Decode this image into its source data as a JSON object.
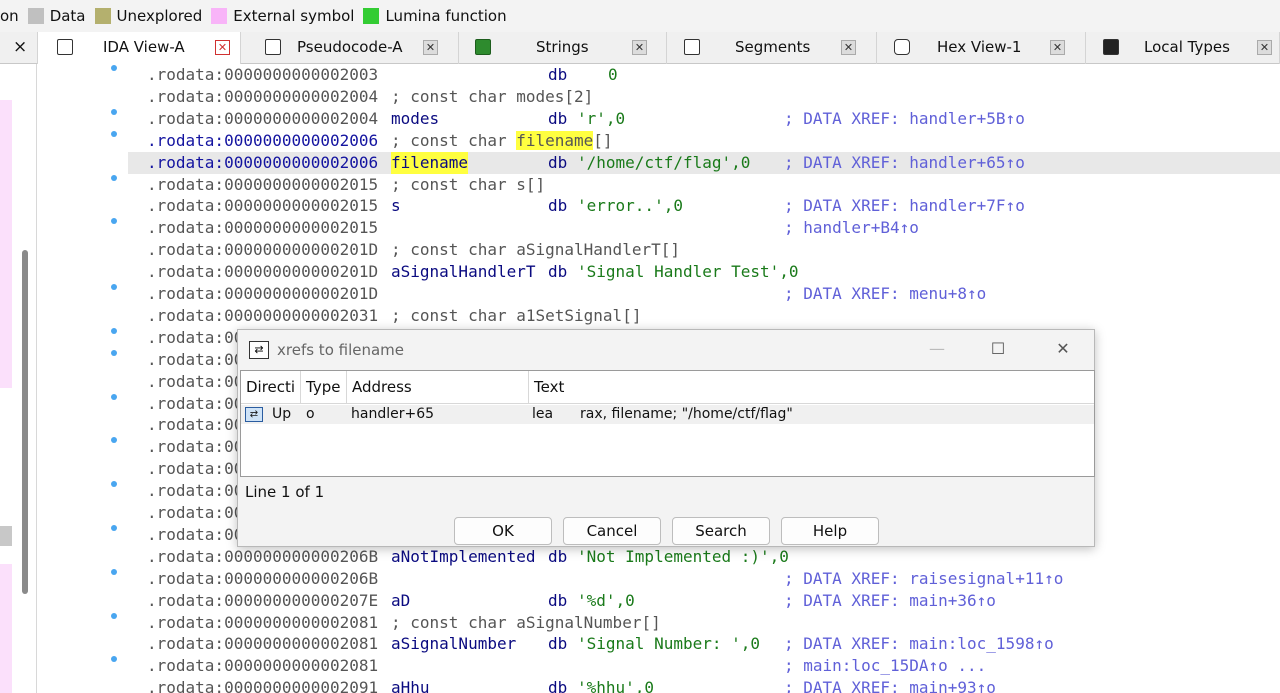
{
  "legend": [
    {
      "label": "on",
      "color": ""
    },
    {
      "label": "Data",
      "color": "#c0c0c0"
    },
    {
      "label": "Unexplored",
      "color": "#b4b06e"
    },
    {
      "label": "External symbol",
      "color": "#f8b4f8"
    },
    {
      "label": "Lumina function",
      "color": "#33cc33"
    }
  ],
  "tabs": [
    {
      "label": "IDA View-A",
      "active": true
    },
    {
      "label": "Pseudocode-A",
      "active": false
    },
    {
      "label": "Strings",
      "active": false
    },
    {
      "label": "Segments",
      "active": false
    },
    {
      "label": "Hex View-1",
      "active": false
    },
    {
      "label": "Local Types",
      "active": false
    }
  ],
  "left_close": "×",
  "listing": [
    {
      "addr": ".rodata:0000000000002003",
      "c3": "db",
      "c4": "0",
      "comment": "",
      "dot": true
    },
    {
      "addr": ".rodata:0000000000002004",
      "decl": "; const char modes[2]",
      "dot": false
    },
    {
      "addr": ".rodata:0000000000002004",
      "name": "modes",
      "c3": "db",
      "c4": "'r',0",
      "comment": "; DATA XREF: handler+5B↑o",
      "dot": true
    },
    {
      "addr": ".rodata:0000000000002006",
      "decl_pre": "; const char ",
      "decl_hl": "filename",
      "decl_post": "[]",
      "dot": true
    },
    {
      "addr": ".rodata:0000000000002006",
      "name_hl": "filename",
      "c3": "db",
      "c4": "'/home/ctf/flag',0",
      "comment": "; DATA XREF: handler+65↑o",
      "dot": false
    },
    {
      "addr": ".rodata:0000000000002015",
      "decl": "; const char s[]",
      "dot": true
    },
    {
      "addr": ".rodata:0000000000002015",
      "name": "s",
      "c3": "db",
      "c4": "'error..',0",
      "comment": "; DATA XREF: handler+7F↑o",
      "dot": false
    },
    {
      "addr": ".rodata:0000000000002015",
      "comment_off": "; handler+B4↑o",
      "dot": true
    },
    {
      "addr": ".rodata:000000000000201D",
      "decl": "; const char aSignalHandlerT[]",
      "dot": false
    },
    {
      "addr": ".rodata:000000000000201D",
      "name": "aSignalHandlerT",
      "c3": "db",
      "c4": "'Signal Handler Test',0",
      "dot": false
    },
    {
      "addr": ".rodata:000000000000201D",
      "comment": "; DATA XREF: menu+8↑o",
      "dot": true
    },
    {
      "addr": ".rodata:0000000000002031",
      "decl": "; const char a1SetSignal[]",
      "dot": false
    },
    {
      "addr": ".rodata:00",
      "dot": true
    },
    {
      "addr": ".rodata:00",
      "dot": true
    },
    {
      "addr": ".rodata:00",
      "dot": false
    },
    {
      "addr": ".rodata:00",
      "dot": true
    },
    {
      "addr": ".rodata:00",
      "dot": false
    },
    {
      "addr": ".rodata:00",
      "dot": true
    },
    {
      "addr": ".rodata:00",
      "dot": false
    },
    {
      "addr": ".rodata:00",
      "dot": true
    },
    {
      "addr": ".rodata:00",
      "dot": false
    },
    {
      "addr": ".rodata:00",
      "dot": true
    },
    {
      "addr": ".rodata:000000000000206B",
      "name": "aNotImplemented",
      "c3": "db",
      "c4": "'Not Implemented :)',0",
      "dot": false
    },
    {
      "addr": ".rodata:000000000000206B",
      "comment": "; DATA XREF: raisesignal+11↑o",
      "dot": true
    },
    {
      "addr": ".rodata:000000000000207E",
      "name": "aD",
      "c3": "db",
      "c4": "'%d',0",
      "comment": "; DATA XREF: main+36↑o",
      "dot": false
    },
    {
      "addr": ".rodata:0000000000002081",
      "decl": "; const char aSignalNumber[]",
      "dot": true
    },
    {
      "addr": ".rodata:0000000000002081",
      "name": "aSignalNumber",
      "c3": "db",
      "c4": "'Signal Number: ',0",
      "comment": "; DATA XREF: main:loc_1598↑o",
      "dot": false
    },
    {
      "addr": ".rodata:0000000000002081",
      "comment": "; main:loc_15DA↑o ...",
      "dot": true
    },
    {
      "addr": ".rodata:0000000000002091",
      "name": "aHhu",
      "c3": "db",
      "c4": "'%hhu',0",
      "comment": "; DATA XREF: main+93↑o",
      "dot": false
    }
  ],
  "dialog": {
    "title": "xrefs to filename",
    "minimize": "—",
    "maximize": "☐",
    "close": "✕",
    "columns": [
      "Directi",
      "Type",
      "Address",
      "Text"
    ],
    "row": {
      "direction": "Up",
      "type": "o",
      "address": "handler+65",
      "mnemonic": "lea",
      "operands": "rax, filename; \"/home/ctf/flag\""
    },
    "status": "Line 1 of 1",
    "buttons": [
      "OK",
      "Cancel",
      "Search",
      "Help"
    ]
  }
}
